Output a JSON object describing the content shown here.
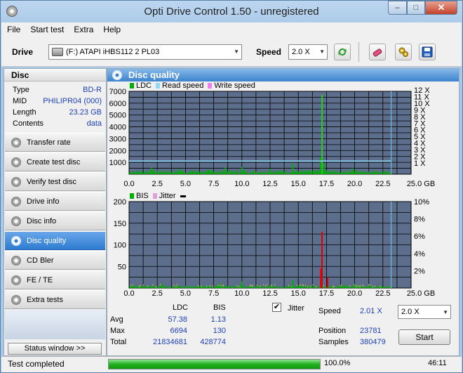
{
  "window": {
    "title": "Opti Drive Control 1.50 - unregistered",
    "min_glyph": "–",
    "max_glyph": "□",
    "close_glyph": "✕"
  },
  "menu": [
    "File",
    "Start test",
    "Extra",
    "Help"
  ],
  "toolbar": {
    "drive_label": "Drive",
    "drive_value": "(F:)   ATAPI iHBS112   2 PL03",
    "speed_label": "Speed",
    "speed_value": "2.0 X",
    "icons": [
      "refresh-icon",
      "eraser-icon",
      "settings-icon",
      "save-icon"
    ]
  },
  "disc": {
    "header": "Disc",
    "rows": [
      {
        "key": "Type",
        "value": "BD-R"
      },
      {
        "key": "MID",
        "value": "PHILIPR04 (000)"
      },
      {
        "key": "Length",
        "value": "23.23 GB"
      },
      {
        "key": "Contents",
        "value": "data"
      }
    ]
  },
  "nav": [
    "Transfer rate",
    "Create test disc",
    "Verify test disc",
    "Drive info",
    "Disc info",
    "Disc quality",
    "CD Bler",
    "FE / TE",
    "Extra tests"
  ],
  "nav_active": "Disc quality",
  "status_window_label": "Status window >>",
  "main_title": "Disc quality",
  "legend_top": [
    "LDC",
    "Read speed",
    "Write speed"
  ],
  "legend_bottom": [
    "BIS",
    "Jitter"
  ],
  "colors": {
    "ldc": "#00b000",
    "read_speed": "#8fd8f8",
    "write_speed": "#f080f0",
    "bis": "#00b000",
    "jitter": "#e0a0e0",
    "plot_bg": "#5d6e8c",
    "grid": "#000000",
    "ldc_spike": "#20d020",
    "bis_spike": "#e00000"
  },
  "chart_data": [
    {
      "type": "bar",
      "name": "LDC",
      "x_ticks": [
        "0.0",
        "2.5",
        "5.0",
        "7.5",
        "10.0",
        "12.5",
        "15.0",
        "17.5",
        "20.0",
        "22.5",
        "25.0 GB"
      ],
      "y_ticks_left": [
        "7000",
        "6000",
        "5000",
        "4000",
        "3000",
        "2000",
        "1000"
      ],
      "y_ticks_right": [
        "12 X",
        "11 X",
        "10 X",
        "9 X",
        "8 X",
        "7 X",
        "6 X",
        "5 X",
        "4 X",
        "3 X",
        "2 X",
        "1 X"
      ],
      "xlim": [
        0,
        25
      ],
      "ylim": [
        0,
        7000
      ],
      "read_speed_x": 2.0,
      "end_marker_gb": 23.23,
      "spikes": [
        [
          17.1,
          6694
        ],
        [
          17.0,
          1400
        ],
        [
          17.3,
          900
        ],
        [
          14.5,
          900
        ],
        [
          10.0,
          600
        ],
        [
          8.5,
          550
        ],
        [
          2.0,
          550
        ],
        [
          19.8,
          500
        ],
        [
          4.5,
          450
        ],
        [
          12.5,
          450
        ]
      ],
      "baseline": 250
    },
    {
      "type": "bar",
      "name": "BIS",
      "x_ticks": [
        "0.0",
        "2.5",
        "5.0",
        "7.5",
        "10.0",
        "12.5",
        "15.0",
        "17.5",
        "20.0",
        "22.5",
        "25.0 GB"
      ],
      "y_ticks_left": [
        "200",
        "150",
        "100",
        "50"
      ],
      "y_ticks_right": [
        "10%",
        "8%",
        "6%",
        "4%",
        "2%"
      ],
      "xlim": [
        0,
        25
      ],
      "ylim": [
        0,
        200
      ],
      "end_marker_gb": 23.23,
      "spikes": [
        [
          17.1,
          130
        ],
        [
          17.0,
          45
        ],
        [
          17.6,
          25
        ],
        [
          14.5,
          18
        ],
        [
          10.0,
          15
        ],
        [
          8.0,
          12
        ],
        [
          20.0,
          10
        ],
        [
          3.0,
          10
        ]
      ],
      "baseline": 4
    }
  ],
  "stats": {
    "col_ldc": "LDC",
    "col_bis": "BIS",
    "jitter_label": "Jitter",
    "jitter_checked": "✔",
    "rows": [
      {
        "label": "Avg",
        "ldc": "57.38",
        "bis": "1.13"
      },
      {
        "label": "Max",
        "ldc": "6694",
        "bis": "130"
      },
      {
        "label": "Total",
        "ldc": "21834681",
        "bis": "428774"
      }
    ],
    "speed_label": "Speed",
    "speed_value": "2.01 X",
    "position_label": "Position",
    "position_value": "23781",
    "samples_label": "Samples",
    "samples_value": "380479",
    "speed_select": "2.0 X",
    "start_label": "Start"
  },
  "status": {
    "text": "Test completed",
    "progress": 100,
    "progress_text": "100.0%",
    "time": "46:11"
  }
}
